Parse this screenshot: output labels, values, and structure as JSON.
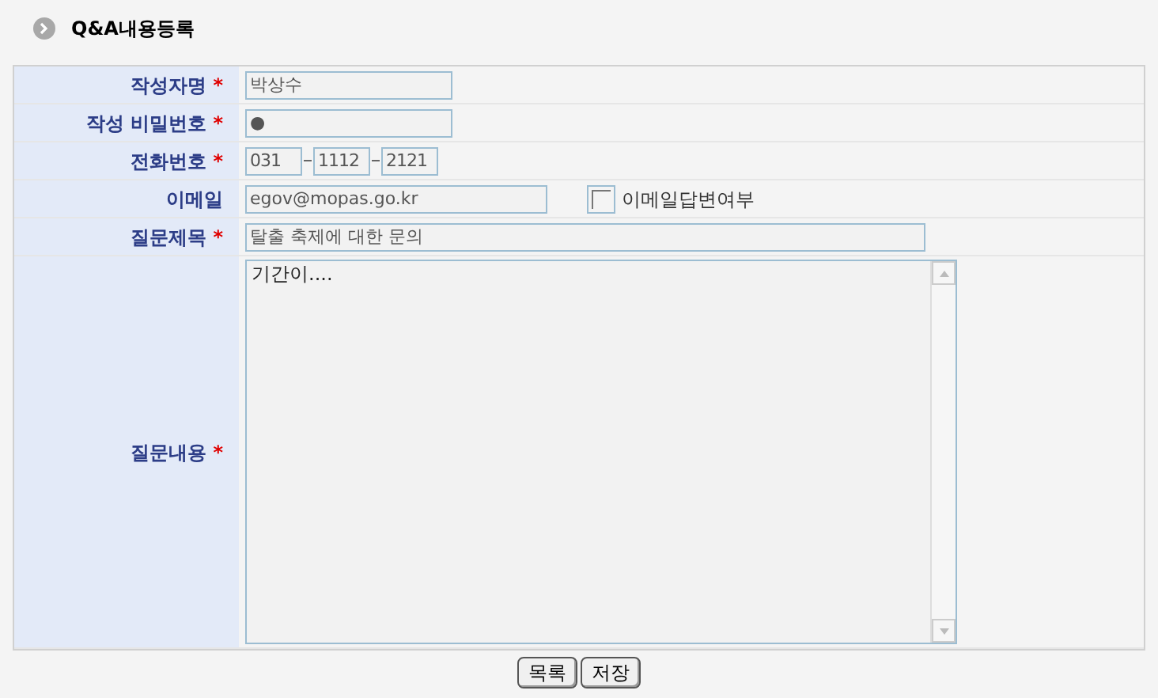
{
  "title": "Q&A내용등록",
  "fields": [
    {
      "kind": "text",
      "label": "작성자명",
      "mark": "*",
      "value": "박상수"
    },
    {
      "kind": "password",
      "label": "작성 비밀번호",
      "mark": "*",
      "value": "●"
    },
    {
      "kind": "phone",
      "label": "전화번호",
      "mark": "*",
      "parts": [
        "031",
        "1112",
        "2121"
      ]
    },
    {
      "kind": "email",
      "label": "이메일",
      "value": "egov@mopas.go.kr",
      "checkbox": {
        "label": "이메일답변여부",
        "checked": false
      }
    },
    {
      "kind": "subject",
      "label": "질문제목",
      "mark": "*",
      "value": "탈출 축제에 대한 문의"
    },
    {
      "kind": "textarea",
      "label": "질문내용",
      "mark": "*",
      "value": "기간이...."
    }
  ],
  "buttons": [
    "목록",
    "저장"
  ]
}
